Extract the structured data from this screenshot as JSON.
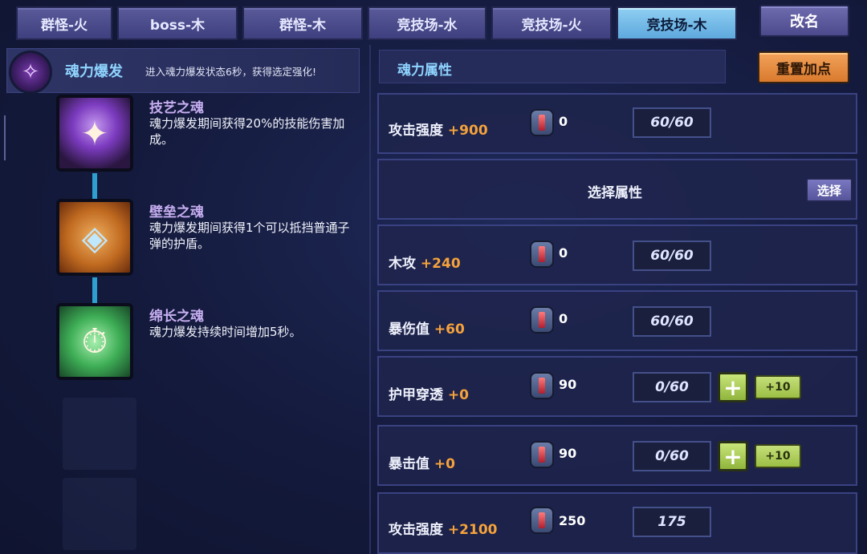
{
  "tabs": [
    {
      "label": "群怪-火",
      "active": false
    },
    {
      "label": "boss-木",
      "active": false
    },
    {
      "label": "群怪-木",
      "active": false
    },
    {
      "label": "竞技场-水",
      "active": false
    },
    {
      "label": "竞技场-火",
      "active": false
    },
    {
      "label": "竞技场-木",
      "active": true
    }
  ],
  "rename_label": "改名",
  "burst": {
    "title": "魂力爆发",
    "desc": "进入魂力爆发状态6秒，获得选定强化!",
    "icon": "soul-burst-icon"
  },
  "souls": [
    {
      "name": "技艺之魂",
      "desc": "魂力爆发期间获得20%的技能伤害加成。",
      "icon": "flame-shell-icon"
    },
    {
      "name": "壁垒之魂",
      "desc": "魂力爆发期间获得1个可以抵挡普通子弹的护盾。",
      "icon": "shield-icon"
    },
    {
      "name": "绵长之魂",
      "desc": "魂力爆发持续时间增加5秒。",
      "icon": "stopwatch-icon"
    }
  ],
  "attributes": {
    "title": "魂力属性",
    "reset_label": "重置加点",
    "select_row": {
      "label": "选择属性",
      "button": "选择"
    },
    "rows": [
      {
        "name": "攻击强度",
        "bonus": "+900",
        "gems": "0",
        "value": "60/60"
      },
      {
        "name": "木攻",
        "bonus": "+240",
        "gems": "0",
        "value": "60/60"
      },
      {
        "name": "暴伤值",
        "bonus": "+60",
        "gems": "0",
        "value": "60/60"
      },
      {
        "name": "护甲穿透",
        "bonus": "+0",
        "gems": "90",
        "value": "0/60",
        "plus": "+",
        "plus10": "+10"
      },
      {
        "name": "暴击值",
        "bonus": "+0",
        "gems": "90",
        "value": "0/60",
        "plus": "+",
        "plus10": "+10"
      },
      {
        "name": "攻击强度",
        "bonus": "+2100",
        "gems": "250",
        "value": "175"
      }
    ]
  }
}
